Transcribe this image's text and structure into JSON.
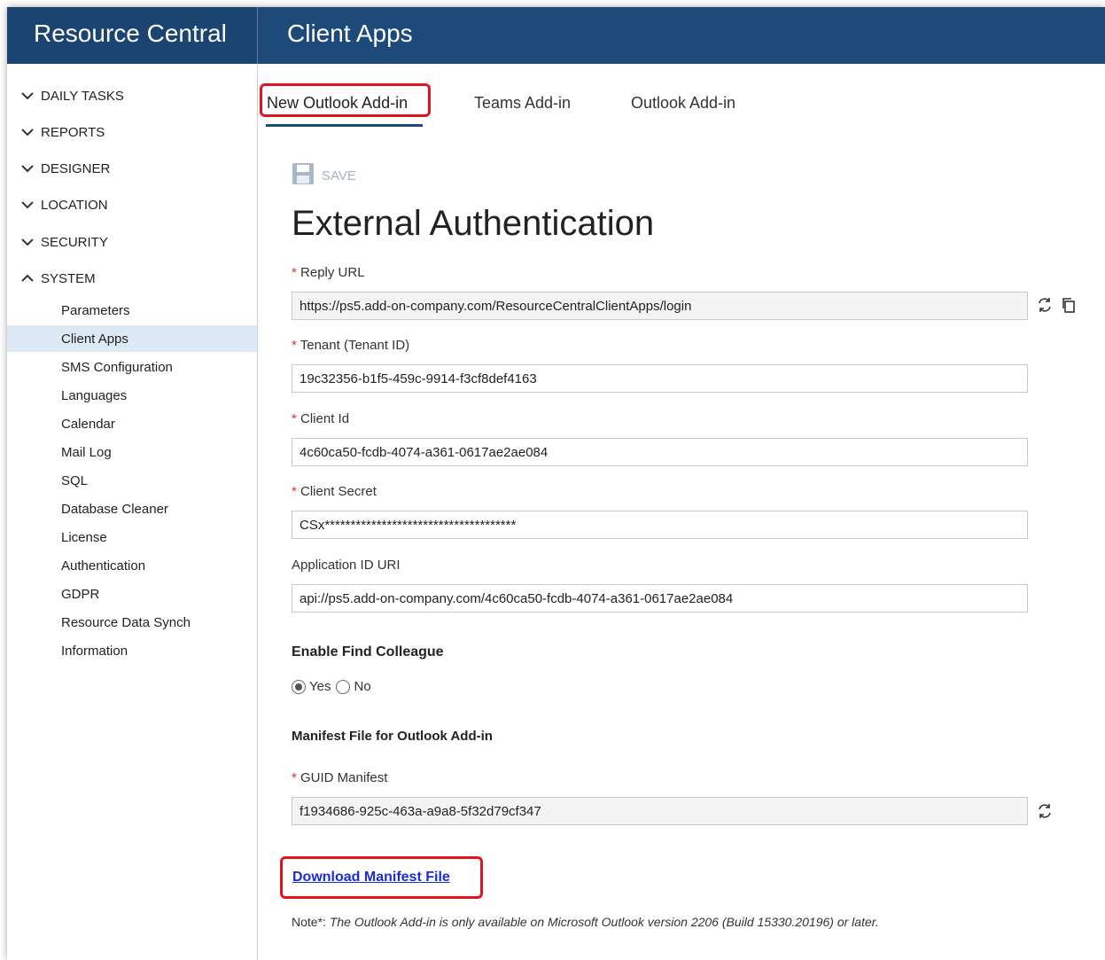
{
  "app": {
    "brand": "Resource Central",
    "page_title": "Client Apps"
  },
  "sidebar": {
    "sections": [
      {
        "label": "DAILY TASKS",
        "expanded": false
      },
      {
        "label": "REPORTS",
        "expanded": false
      },
      {
        "label": "DESIGNER",
        "expanded": false
      },
      {
        "label": "LOCATION",
        "expanded": false
      },
      {
        "label": "SECURITY",
        "expanded": false
      },
      {
        "label": "SYSTEM",
        "expanded": true
      }
    ],
    "system_items": [
      "Parameters",
      "Client Apps",
      "SMS Configuration",
      "Languages",
      "Calendar",
      "Mail Log",
      "SQL",
      "Database Cleaner",
      "License",
      "Authentication",
      "GDPR",
      "Resource Data Synch",
      "Information"
    ],
    "active_item": "Client Apps"
  },
  "tabs": [
    {
      "label": "New Outlook Add-in",
      "active": true
    },
    {
      "label": "Teams Add-in",
      "active": false
    },
    {
      "label": "Outlook Add-in",
      "active": false
    }
  ],
  "toolbar": {
    "save_label": "SAVE"
  },
  "form": {
    "heading": "External Authentication",
    "reply_url": {
      "label": "Reply URL",
      "required": true,
      "value": "https://ps5.add-on-company.com/ResourceCentralClientApps/login"
    },
    "tenant": {
      "label": "Tenant (Tenant ID)",
      "required": true,
      "value": "19c32356-b1f5-459c-9914-f3cf8def4163"
    },
    "client_id": {
      "label": "Client Id",
      "required": true,
      "value": "4c60ca50-fcdb-4074-a361-0617ae2ae084"
    },
    "client_secret": {
      "label": "Client Secret",
      "required": true,
      "value": "CSx*************************************"
    },
    "app_id_uri": {
      "label": "Application ID URI",
      "required": false,
      "value": "api://ps5.add-on-company.com/4c60ca50-fcdb-4074-a361-0617ae2ae084"
    },
    "find_colleague": {
      "label": "Enable Find Colleague",
      "options": [
        "Yes",
        "No"
      ],
      "selected": "Yes"
    },
    "manifest_heading": "Manifest File for Outlook Add-in",
    "guid_manifest": {
      "label": "GUID Manifest",
      "required": true,
      "value": "f1934686-925c-463a-a9a8-5f32d79cf347"
    },
    "download_link": "Download Manifest File",
    "note_prefix": "Note*: ",
    "note_text": "The Outlook Add-in is only available on Microsoft Outlook version 2206 (Build 15330.20196) or later."
  },
  "colors": {
    "header_bg": "#1e4a7a",
    "active_item_bg": "#dde9f5",
    "highlight_border": "#e0141e",
    "link": "#1a2bd8"
  },
  "required_marker": "*"
}
